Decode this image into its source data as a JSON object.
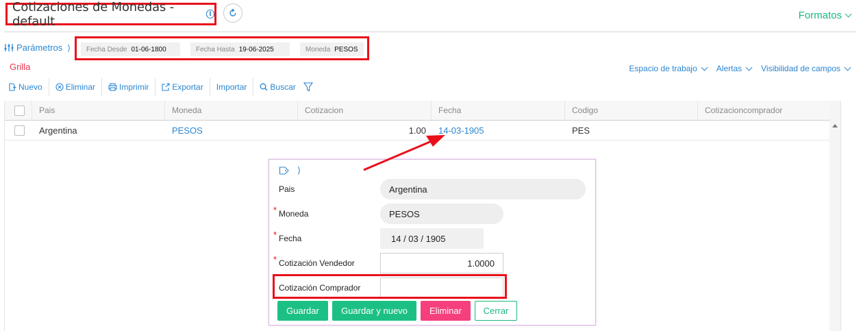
{
  "header": {
    "title": "Cotizaciones de Monedas - default",
    "info_glyph": "i",
    "formatos_label": "Formatos"
  },
  "params": {
    "label": "Parámetros",
    "arrow": "⟩",
    "fecha_desde_label": "Fecha Desde",
    "fecha_desde_value": "01-06-1800",
    "fecha_hasta_label": "Fecha Hasta",
    "fecha_hasta_value": "19-06-2025",
    "moneda_label": "Moneda",
    "moneda_value": "PESOS"
  },
  "grilla_label": "Grilla",
  "right_links": {
    "espacio": "Espacio de trabajo",
    "alertas": "Alertas",
    "visibilidad": "Visibilidad de campos"
  },
  "toolbar": {
    "nuevo": "Nuevo",
    "eliminar": "Eliminar",
    "imprimir": "Imprimir",
    "exportar": "Exportar",
    "importar": "Importar",
    "buscar": "Buscar"
  },
  "grid": {
    "columns": [
      "Pais",
      "Moneda",
      "Cotizacion",
      "Fecha",
      "Codigo",
      "Cotizacioncomprador"
    ],
    "rows": [
      {
        "pais": "Argentina",
        "moneda": "PESOS",
        "cotizacion": "1.00",
        "fecha": "14-03-1905",
        "codigo": "PES",
        "cotizacioncomprador": ""
      }
    ]
  },
  "form": {
    "arrow": "⟩",
    "pais_label": "Pais",
    "pais_value": "Argentina",
    "moneda_label": "Moneda",
    "moneda_value": "PESOS",
    "fecha_label": "Fecha",
    "fecha_value": "14 / 03 / 1905",
    "vendedor_label": "Cotización Vendedor",
    "vendedor_value": "1.0000",
    "comprador_label": "Cotización Comprador",
    "comprador_value": "",
    "required_mark": "*",
    "guardar": "Guardar",
    "guardar_nuevo": "Guardar y nuevo",
    "eliminar": "Eliminar",
    "cerrar": "Cerrar"
  },
  "colors": {
    "accent_blue": "#2a86d1",
    "accent_green": "#1bb87f",
    "highlight_red": "#e8101a",
    "delete_pink": "#f5407d"
  }
}
